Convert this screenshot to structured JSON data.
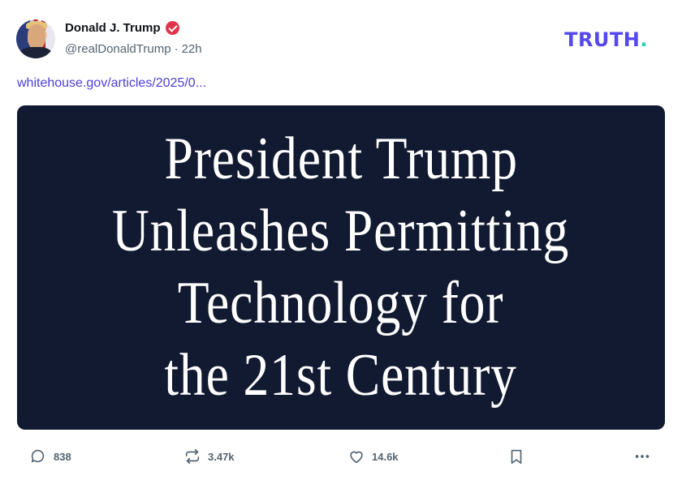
{
  "post": {
    "author": {
      "display_name": "Donald J. Trump",
      "handle": "@realDonaldTrump",
      "separator": "·",
      "time_ago": "22h"
    },
    "brand": {
      "name": "TRUTH",
      "dot": "."
    },
    "link_text": "whitehouse.gov/articles/2025/0...",
    "card": {
      "lines": [
        "President Trump",
        "Unleashes Permitting",
        "Technology for",
        "the 21st Century"
      ]
    },
    "actions": {
      "replies": "838",
      "retruths": "3.47k",
      "likes": "14.6k"
    }
  },
  "colors": {
    "brand_purple": "#5448ee",
    "brand_dot": "#20d6b5",
    "verified_badge": "#e0334c",
    "link": "#4b3fd6",
    "card_background": "#111a31",
    "muted_text": "#536471"
  },
  "icons": [
    "verified-badge-icon",
    "reply-icon",
    "retruth-icon",
    "like-icon",
    "bookmark-icon",
    "more-icon"
  ]
}
